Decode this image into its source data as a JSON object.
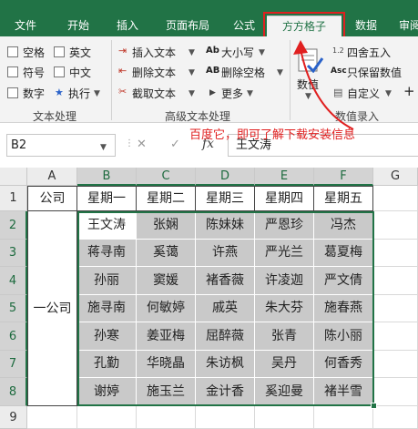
{
  "tabs": [
    "文件",
    "开始",
    "插入",
    "页面布局",
    "公式",
    "方方格子",
    "数据",
    "审阅"
  ],
  "active_tab": "方方格子",
  "ribbon": {
    "text_group": {
      "checkboxes": [
        "空格",
        "英文",
        "符号",
        "中文",
        "数字"
      ],
      "execute_label": "执行",
      "label": "文本处理"
    },
    "advanced_group": {
      "items": [
        "插入文本",
        "删除文本",
        "截取文本",
        "大小写",
        "删除空格",
        "更多"
      ],
      "case_prefix": "Ab",
      "space_prefix": "AB",
      "label": "高级文本处理"
    },
    "number_group": {
      "value_label": "数值",
      "items": [
        "四舍五入",
        "只保留数值",
        "自定义"
      ],
      "round_prefix": "1.2",
      "keep_prefix": "Asc",
      "plus": "+",
      "label": "数值录入"
    }
  },
  "formula_bar": {
    "name_box": "B2",
    "fx": "fx",
    "cancel": "✕",
    "confirm": "✓",
    "content": "王文涛"
  },
  "annotation": "百度它，即可了解下载安装信息",
  "sheet": {
    "columns": [
      "A",
      "B",
      "C",
      "D",
      "E",
      "F",
      "G"
    ],
    "rows": [
      "1",
      "2",
      "3",
      "4",
      "5",
      "6",
      "7",
      "8",
      "9"
    ],
    "header_row": [
      "公司",
      "星期一",
      "星期二",
      "星期三",
      "星期四",
      "星期五"
    ],
    "merged_company": "一公司",
    "data": [
      [
        "王文涛",
        "张娴",
        "陈妹妹",
        "严恩珍",
        "冯杰"
      ],
      [
        "蒋寻南",
        "奚蔼",
        "许燕",
        "严光兰",
        "葛夏梅"
      ],
      [
        "孙丽",
        "窦媛",
        "褚香薇",
        "许凌迦",
        "严文倩"
      ],
      [
        "施寻南",
        "何敏婷",
        "戚英",
        "朱大芬",
        "施春燕"
      ],
      [
        "孙寒",
        "姜亚梅",
        "屈醉薇",
        "张青",
        "陈小丽"
      ],
      [
        "孔勤",
        "华晓晶",
        "朱访枫",
        "吴丹",
        "何香秀"
      ],
      [
        "谢婷",
        "施玉兰",
        "金计香",
        "奚迎曼",
        "褚半雪"
      ]
    ]
  }
}
